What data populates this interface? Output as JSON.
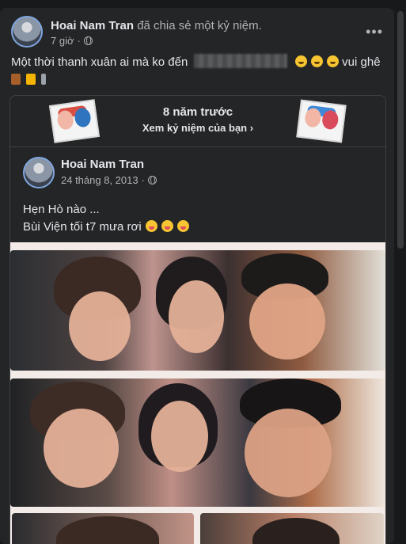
{
  "post": {
    "author": "Hoai Nam Tran",
    "action": "đã chia sẻ một kỷ niệm.",
    "time": "7 giờ",
    "text_before": "Một thời thanh xuân ai mà ko đến",
    "text_after": "vui ghê"
  },
  "memory": {
    "title": "8 năm trước",
    "subtitle": "Xem kỷ niệm của bạn",
    "subtitle_chevron": "›",
    "original_post": {
      "author": "Hoai Nam Tran",
      "date": "24 tháng 8, 2013",
      "line1": "Hẹn Hò nào ...",
      "line2": "Bùi Viện tối t7 mưa rơi"
    }
  },
  "icons": {
    "more": "more-icon",
    "globe": "globe-icon",
    "chevron": "chevron-right-icon"
  }
}
